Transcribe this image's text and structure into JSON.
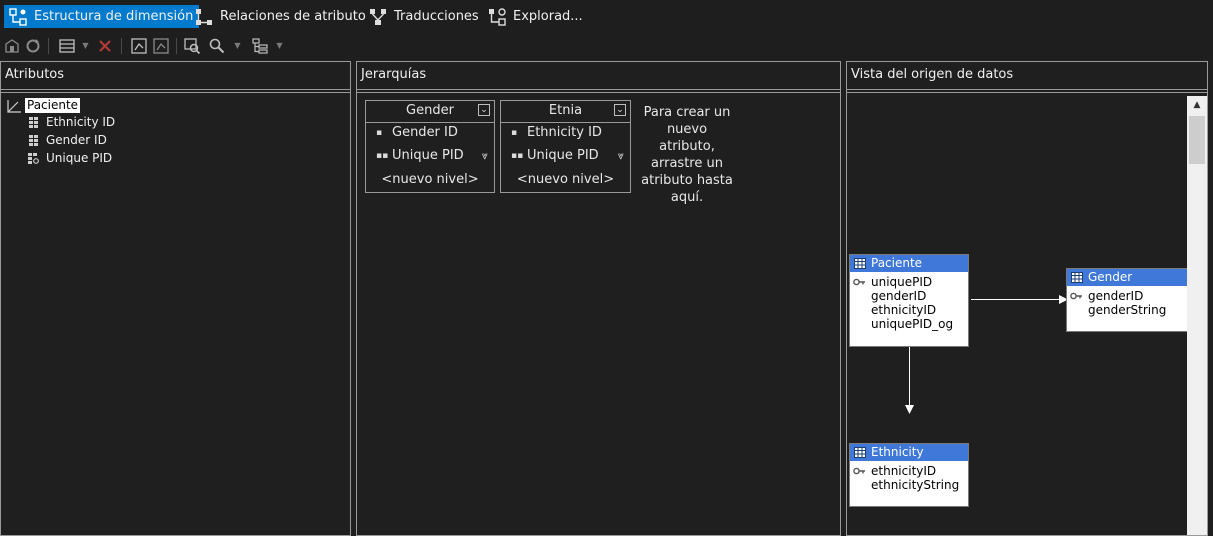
{
  "tabs": [
    {
      "label": "Estructura de dimensión",
      "icon": "dimension-structure-icon",
      "active": true
    },
    {
      "label": "Relaciones de atributo",
      "icon": "attribute-relationships-icon",
      "active": false
    },
    {
      "label": "Traducciones",
      "icon": "translations-icon",
      "active": false
    },
    {
      "label": "Explorad...",
      "icon": "browser-icon",
      "active": false
    }
  ],
  "toolbar": {
    "buttons": [
      "process-icon",
      "refresh-icon",
      "show-table-icon",
      "delete-icon",
      "new-hierarchy-icon",
      "show-attributes-icon",
      "zoom-icon",
      "find-icon",
      "tree-view-icon"
    ]
  },
  "attributes": {
    "title": "Atributos",
    "root": "Paciente",
    "items": [
      "Ethnicity ID",
      "Gender ID",
      "Unique PID"
    ]
  },
  "hierarchies": {
    "title": "Jerarquías",
    "boxes": [
      {
        "name": "Gender",
        "levels": [
          "Gender ID",
          "Unique PID"
        ],
        "new_level": "<nuevo nivel>"
      },
      {
        "name": "Etnia",
        "levels": [
          "Ethnicity ID",
          "Unique PID"
        ],
        "new_level": "<nuevo nivel>"
      }
    ],
    "hint": "Para crear un nuevo atributo, arrastre un atributo hasta aquí."
  },
  "dsv": {
    "title": "Vista del origen de datos",
    "tables": [
      {
        "name": "Paciente",
        "columns": [
          "uniquePID",
          "genderID",
          "ethnicityID",
          "uniquePID_og"
        ],
        "key_column": 0
      },
      {
        "name": "Gender",
        "columns": [
          "genderID",
          "genderString"
        ],
        "key_column": 0
      },
      {
        "name": "Ethnicity",
        "columns": [
          "ethnicityID",
          "ethnicityString"
        ],
        "key_column": 0
      }
    ]
  },
  "colors": {
    "accent": "#007acc",
    "background": "#1f1f1f",
    "table_header": "#3f78d8",
    "border": "#9a9a9a"
  }
}
